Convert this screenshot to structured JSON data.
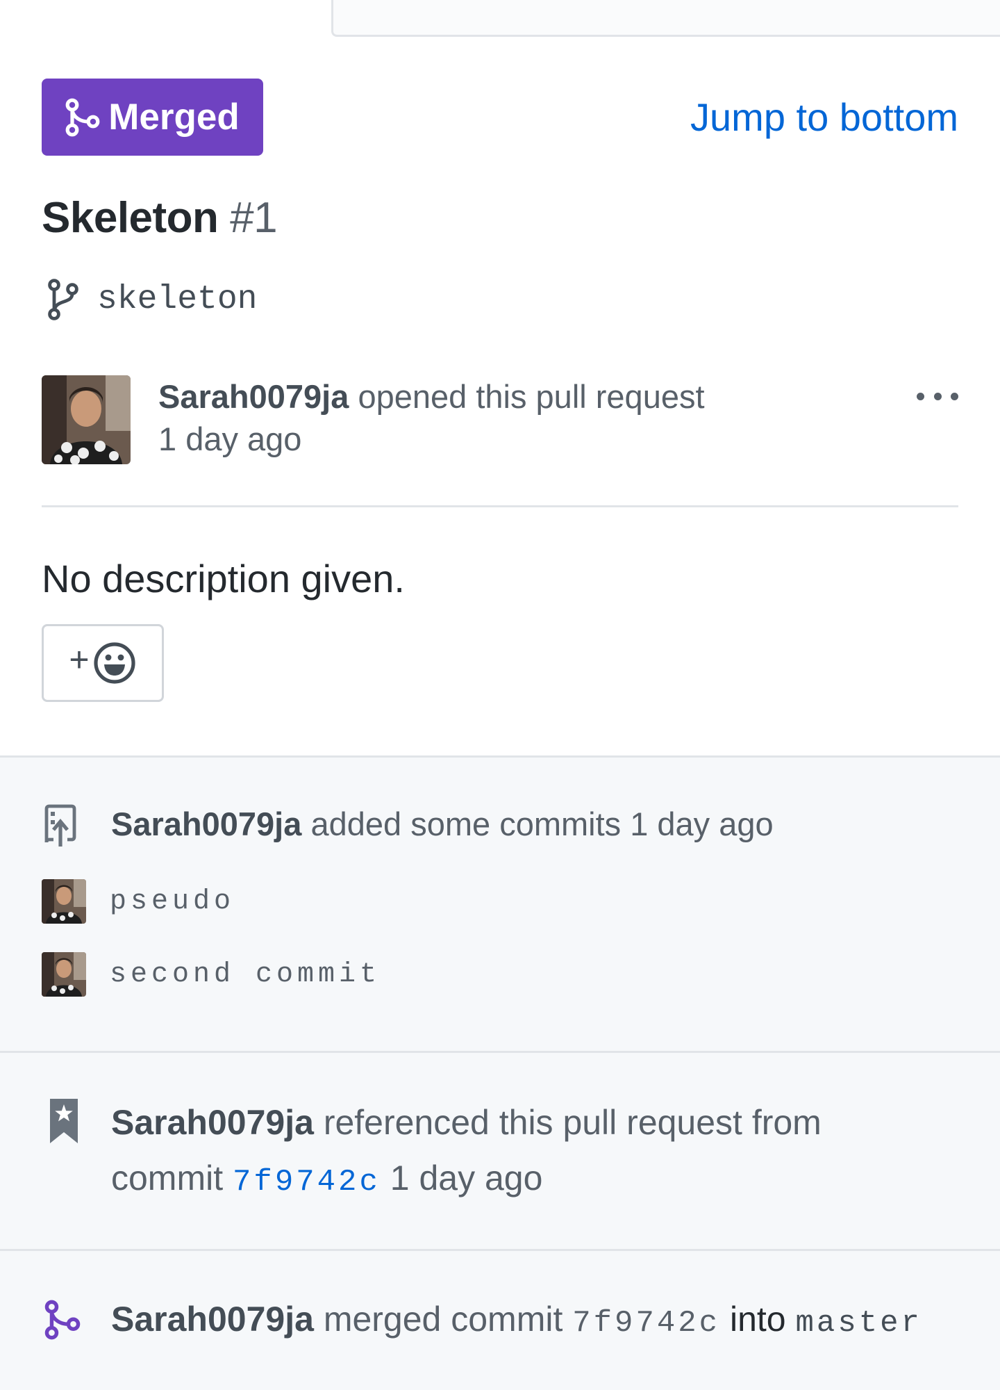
{
  "header": {
    "status_label": "Merged",
    "jump_link": "Jump to bottom"
  },
  "pr": {
    "title": "Skeleton",
    "number": "#1",
    "branch": "skeleton",
    "author": "Sarah0079ja",
    "opened_text": "opened this pull request",
    "opened_time": "1 day ago",
    "description": "No description given.",
    "reaction_plus": "+"
  },
  "timeline": {
    "commits_event": {
      "actor": "Sarah0079ja",
      "text": "added some commits 1 day ago",
      "commits": [
        {
          "message": "pseudo"
        },
        {
          "message": "second commit"
        }
      ]
    },
    "reference_event": {
      "actor": "Sarah0079ja",
      "text": "referenced this pull request from",
      "commit_word": "commit",
      "sha": "7f9742c",
      "time": "1 day ago"
    },
    "merge_event": {
      "actor": "Sarah0079ja",
      "text": "merged commit",
      "sha": "7f9742c",
      "into_text": "into",
      "branch": "master"
    }
  },
  "colors": {
    "merged_purple": "#6f42c1",
    "link_blue": "#0366d6",
    "timeline_bg": "#f6f8fa"
  }
}
